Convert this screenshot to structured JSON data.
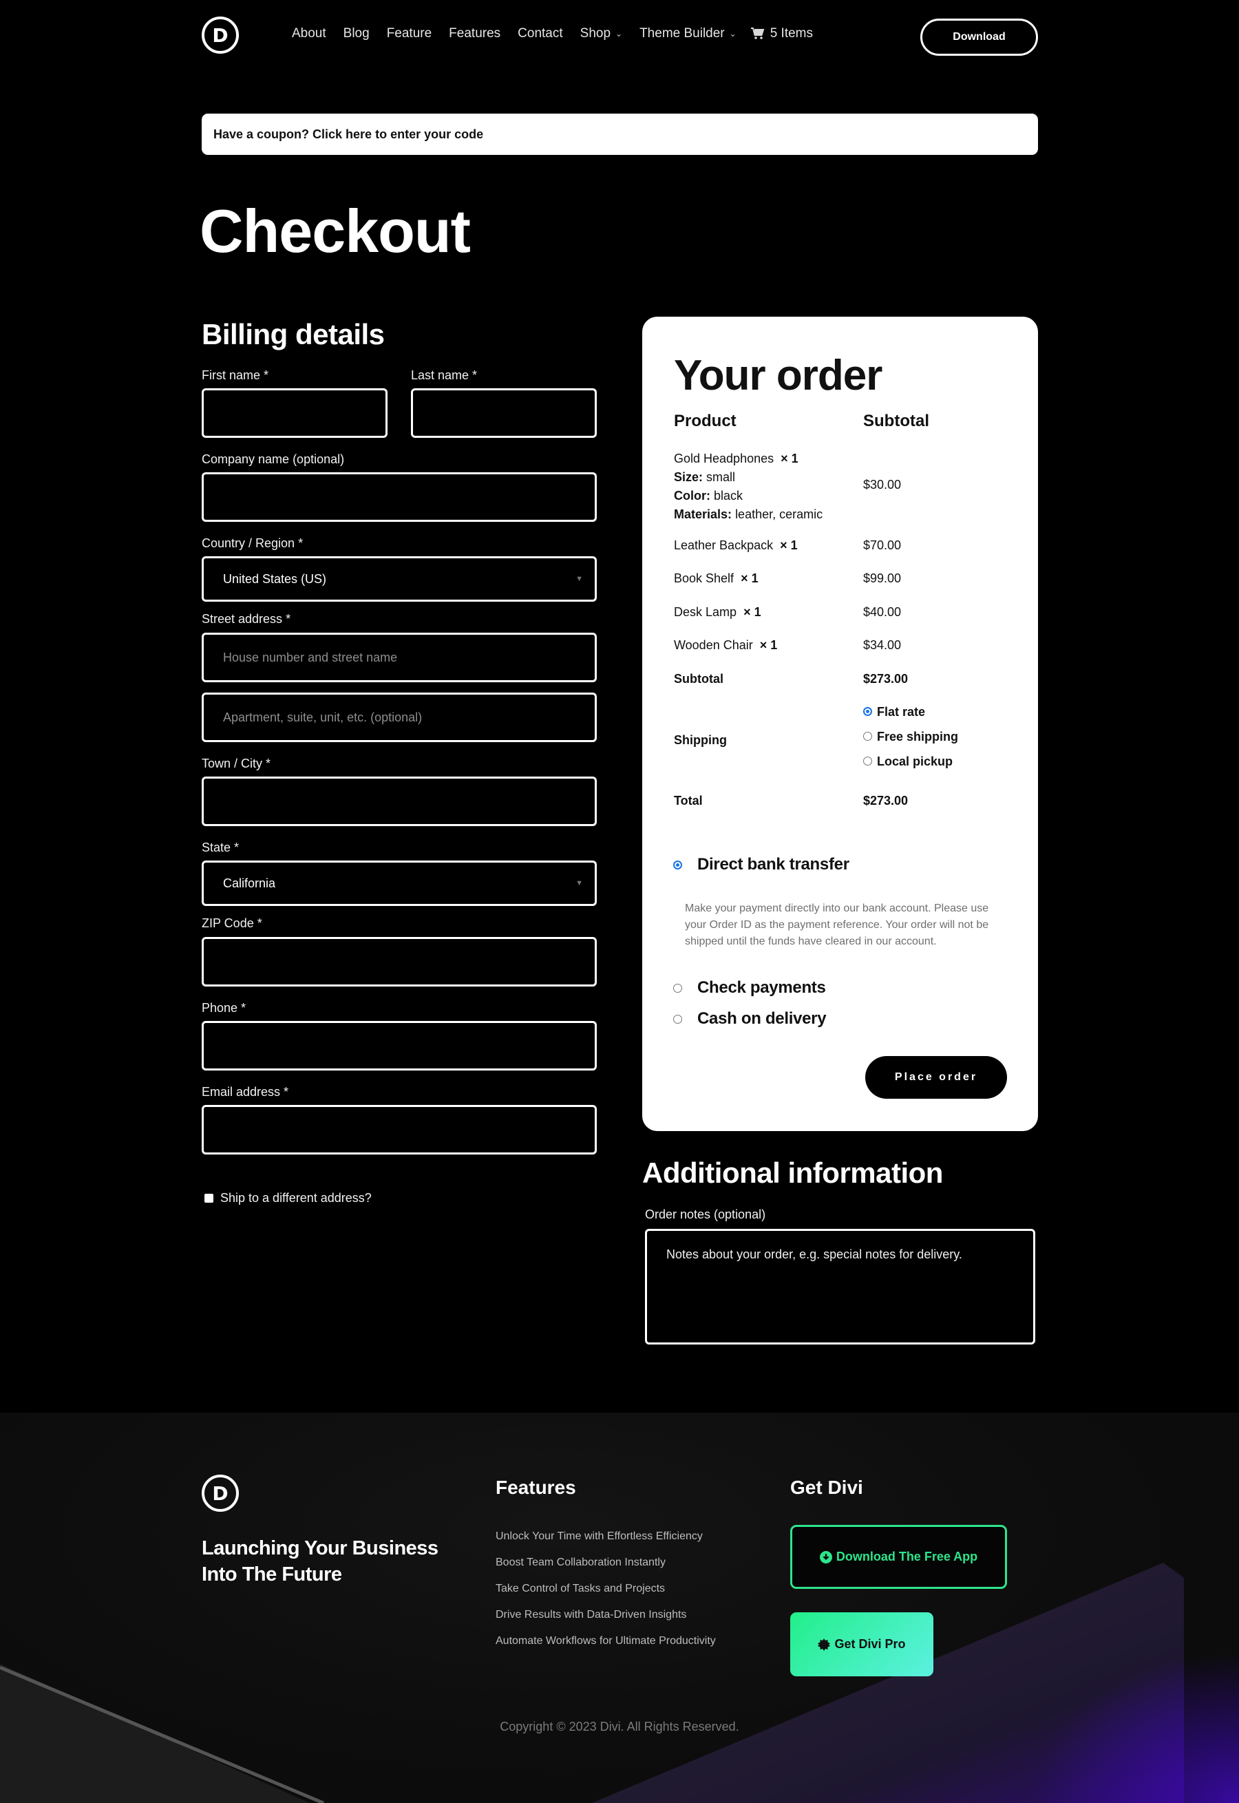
{
  "header": {
    "logo_letter": "D",
    "nav": [
      {
        "label": "About",
        "has_dropdown": false
      },
      {
        "label": "Blog",
        "has_dropdown": false
      },
      {
        "label": "Feature",
        "has_dropdown": false
      },
      {
        "label": "Features",
        "has_dropdown": false
      },
      {
        "label": "Contact",
        "has_dropdown": false
      },
      {
        "label": "Shop",
        "has_dropdown": true
      },
      {
        "label": "Theme Builder",
        "has_dropdown": true
      }
    ],
    "cart_label": "5 Items",
    "download_label": "Download"
  },
  "coupon": {
    "text": "Have a coupon? Click here to enter your code"
  },
  "page_title": "Checkout",
  "billing": {
    "title": "Billing details",
    "first_name": {
      "label": "First name *",
      "value": ""
    },
    "last_name": {
      "label": "Last name *",
      "value": ""
    },
    "company": {
      "label": "Company name (optional)",
      "value": ""
    },
    "country": {
      "label": "Country / Region *",
      "value": "United States (US)"
    },
    "street": {
      "label": "Street address *",
      "placeholder1": "House number and street name",
      "placeholder2": "Apartment, suite, unit, etc. (optional)"
    },
    "city": {
      "label": "Town / City *",
      "value": ""
    },
    "state": {
      "label": "State *",
      "value": "California"
    },
    "zip": {
      "label": "ZIP Code *",
      "value": ""
    },
    "phone": {
      "label": "Phone *",
      "value": ""
    },
    "email": {
      "label": "Email address *",
      "value": ""
    },
    "ship_different": {
      "label": "Ship to a different address?",
      "checked": false
    }
  },
  "order": {
    "title": "Your order",
    "col_product": "Product",
    "col_subtotal": "Subtotal",
    "items": [
      {
        "name": "Gold Headphones",
        "qty": "× 1",
        "price": "$30.00",
        "meta": [
          {
            "key": "Size:",
            "value": "small"
          },
          {
            "key": "Color:",
            "value": "black"
          },
          {
            "key": "Materials:",
            "value": "leather, ceramic"
          }
        ]
      },
      {
        "name": "Leather Backpack",
        "qty": "× 1",
        "price": "$70.00"
      },
      {
        "name": "Book Shelf",
        "qty": "× 1",
        "price": "$99.00"
      },
      {
        "name": "Desk Lamp",
        "qty": "× 1",
        "price": "$40.00"
      },
      {
        "name": "Wooden Chair",
        "qty": "× 1",
        "price": "$34.00"
      }
    ],
    "subtotal_label": "Subtotal",
    "subtotal_value": "$273.00",
    "shipping_label": "Shipping",
    "shipping_options": [
      {
        "label": "Flat rate",
        "selected": true
      },
      {
        "label": "Free shipping",
        "selected": false
      },
      {
        "label": "Local pickup",
        "selected": false
      }
    ],
    "total_label": "Total",
    "total_value": "$273.00",
    "payment_methods": [
      {
        "label": "Direct bank transfer",
        "selected": true
      },
      {
        "label": "Check payments",
        "selected": false
      },
      {
        "label": "Cash on delivery",
        "selected": false
      }
    ],
    "bank_description": "Make your payment directly into our bank account. Please use your Order ID as the payment reference. Your order will not be shipped until the funds have cleared in our account.",
    "place_order_label": "Place order"
  },
  "additional": {
    "title": "Additional information",
    "notes_label": "Order notes (optional)",
    "notes_placeholder": "Notes about your order, e.g. special notes for delivery."
  },
  "footer": {
    "logo_letter": "D",
    "tagline_line1": "Launching Your Business",
    "tagline_line2": "Into The Future",
    "features_title": "Features",
    "features": [
      "Unlock Your Time with Effortless Efficiency",
      "Boost Team Collaboration Instantly",
      "Take Control of Tasks and Projects",
      "Drive Results with Data-Driven Insights",
      "Automate Workflows for Ultimate Productivity"
    ],
    "get_divi_title": "Get Divi",
    "free_app_label": "Download The Free App",
    "pro_label": "Get Divi Pro",
    "copyright": "Copyright © 2023 Divi. All Rights Reserved."
  },
  "colors": {
    "accent_green": "#2de58a",
    "radio_blue": "#1a73e8",
    "background": "#000000",
    "card": "#ffffff"
  }
}
